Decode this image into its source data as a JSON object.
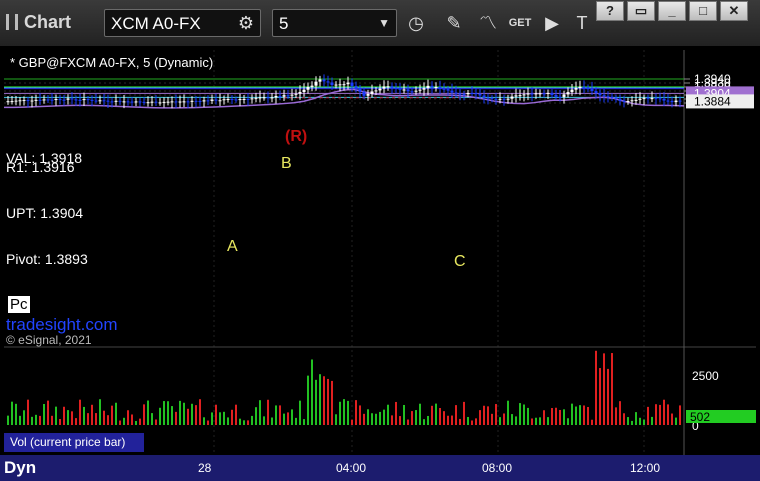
{
  "app": {
    "title": "Chart"
  },
  "toolbar": {
    "symbol": "XCM A0-FX",
    "interval": "5"
  },
  "chart": {
    "header": "* GBP@FXCM A0-FX, 5 (Dynamic)",
    "copyright": "© eSignal, 2021",
    "watermark": "tradesight.com",
    "levels": {
      "val": "VAL: 1.3918",
      "r1": "R1: 1.3916",
      "upt": "UPT: 1.3904",
      "pivot": "Pivot: 1.3893"
    },
    "marks": {
      "a": "A",
      "b": "B",
      "c": "C",
      "r": "(R)",
      "pc": "Pc"
    },
    "price_labels": [
      "1.3940",
      "1.3930",
      "1.3920",
      "1.3910",
      "1.3900",
      "1.3890",
      "1.3880"
    ],
    "badges": {
      "upt": "1.3904",
      "last": "1.3884",
      "vol": "502"
    },
    "volume_labels": [
      "2500",
      "0"
    ],
    "time_labels": [
      "28",
      "04:00",
      "08:00",
      "12:00"
    ],
    "volume_title": "Vol (current price bar)"
  },
  "bottombar": {
    "label": "Dyn"
  },
  "colors": {
    "up": "#ffffff",
    "down": "#1a3dff",
    "vol_up": "#22c022",
    "vol_down": "#e02020",
    "val_line": "#22aa22",
    "r1_line": "#2b2bdd",
    "upt_line": "#a070d0",
    "pivot_line": "#40c8e0",
    "ma_line": "#9a6ad6"
  }
}
